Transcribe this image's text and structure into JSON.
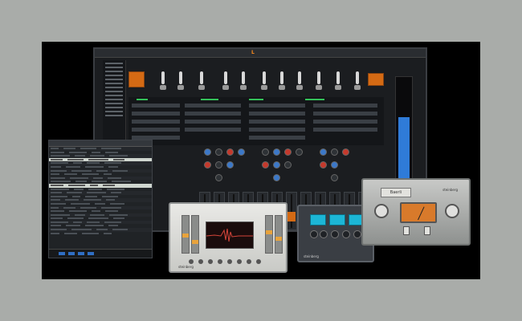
{
  "scene": {
    "description_colors": {
      "background": "#a9aca9",
      "accent_orange": "#d46a14",
      "meter_blue": "#2f7bd8",
      "cyan_display": "#1cb6d6"
    }
  },
  "monitor": {
    "menubar": [
      "",
      "",
      "",
      ""
    ],
    "logo_text": "L"
  },
  "left_panel": {
    "header": "",
    "rows": [
      {
        "selected": false
      },
      {
        "selected": false
      },
      {
        "selected": false
      },
      {
        "selected": true
      },
      {
        "selected": false
      },
      {
        "selected": false
      },
      {
        "selected": false
      },
      {
        "selected": false
      },
      {
        "selected": false
      },
      {
        "selected": false
      },
      {
        "selected": true
      },
      {
        "selected": false
      },
      {
        "selected": false
      },
      {
        "selected": false
      },
      {
        "selected": false
      },
      {
        "selected": false
      },
      {
        "selected": false
      },
      {
        "selected": false
      },
      {
        "selected": false
      },
      {
        "selected": false
      },
      {
        "selected": false
      },
      {
        "selected": false
      },
      {
        "selected": false
      },
      {
        "selected": false
      }
    ]
  },
  "plugins": {
    "deesser": {
      "brand": "steinberg"
    },
    "dark": {
      "brand": "steinberg"
    },
    "tape": {
      "nameplate": "Baerli",
      "brand": "steinberg"
    }
  }
}
